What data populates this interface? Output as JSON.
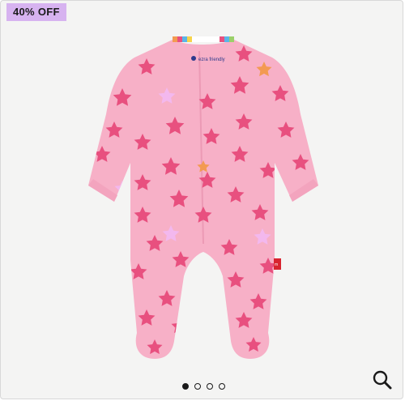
{
  "badge": {
    "label": "40% OFF"
  },
  "product_image": {
    "alt": "Pink footed sleeper with star print",
    "label_text": "ezra friendly"
  },
  "carousel": {
    "count": 4,
    "active": 0
  },
  "colors": {
    "badge_bg": "#d7b3f0",
    "garment": "#f7b0c7",
    "star_dark": "#e8507f",
    "star_light": "#f3b8ee",
    "star_orange": "#f39a52"
  },
  "icons": {
    "zoom": "search-icon"
  }
}
